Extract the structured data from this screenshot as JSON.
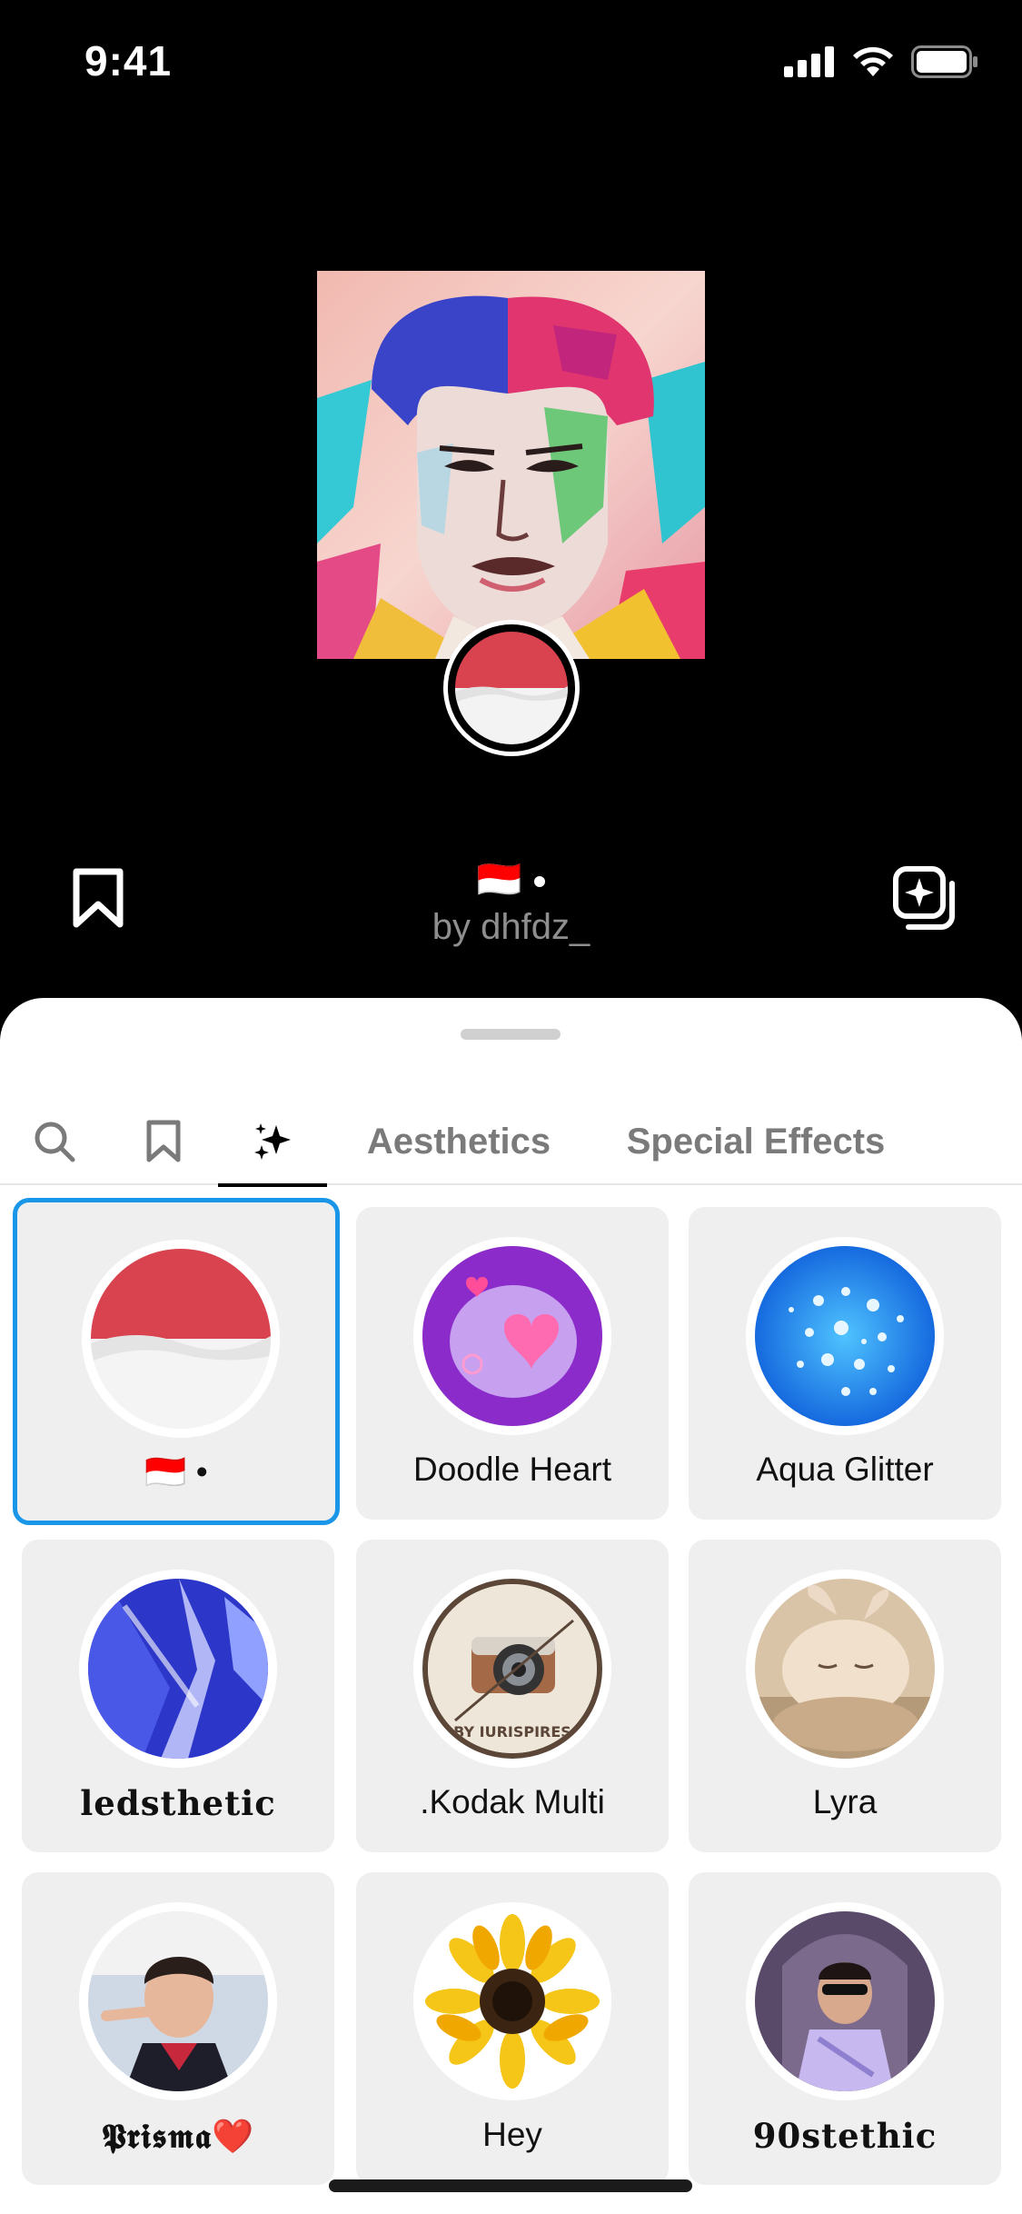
{
  "status": {
    "time": "9:41"
  },
  "preview": {
    "effect_title": "🇮🇩",
    "author": "by dhfdz_"
  },
  "tabs": {
    "aesthetics": "Aesthetics",
    "special_effects": "Special Effects"
  },
  "effects": [
    {
      "label": "🇮🇩 •",
      "selected": true
    },
    {
      "label": "Doodle Heart"
    },
    {
      "label": "Aqua Glitter"
    },
    {
      "label": "ledsthetic"
    },
    {
      "label": ".Kodak Multi",
      "thumb_text": "BY IURISPIRES"
    },
    {
      "label": "Lyra"
    },
    {
      "label": "𝕻𝖗𝖎𝖘𝖒𝖆❤️"
    },
    {
      "label": "Hey"
    },
    {
      "label": "90stethic"
    }
  ],
  "colors": {
    "accent": "#1a96e8",
    "flag_red": "#d8434f",
    "sheet_bg": "#ffffff"
  }
}
